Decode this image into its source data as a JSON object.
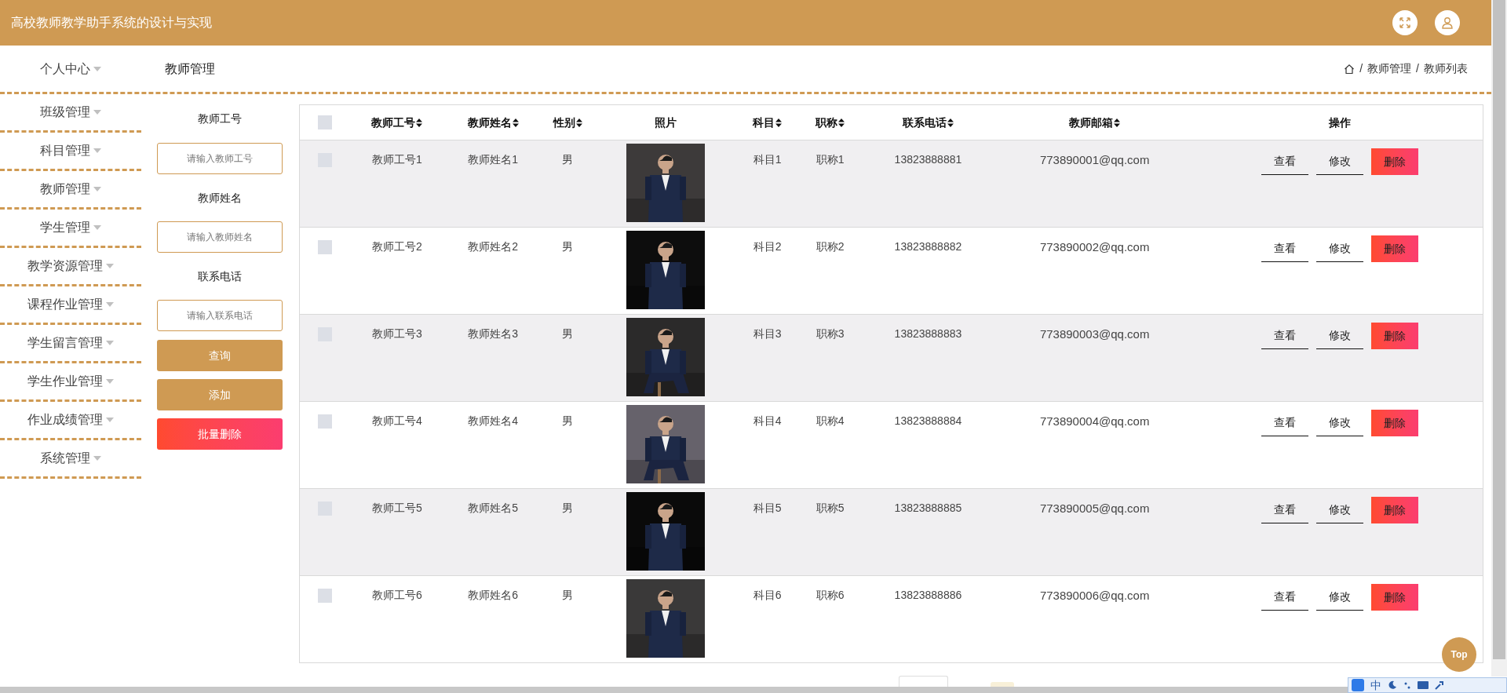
{
  "header": {
    "title": "高校教师教学助手系统的设计与实现"
  },
  "sidebar": {
    "items": [
      {
        "label": "个人中心"
      },
      {
        "label": "班级管理"
      },
      {
        "label": "科目管理"
      },
      {
        "label": "教师管理"
      },
      {
        "label": "学生管理"
      },
      {
        "label": "教学资源管理"
      },
      {
        "label": "课程作业管理"
      },
      {
        "label": "学生留言管理"
      },
      {
        "label": "学生作业管理"
      },
      {
        "label": "作业成绩管理"
      },
      {
        "label": "系统管理"
      }
    ]
  },
  "page_title": "教师管理",
  "breadcrumb": [
    {
      "separator": "/",
      "label": "教师管理"
    },
    {
      "separator": "/",
      "label": "教师列表"
    }
  ],
  "search": {
    "fields": [
      {
        "label": "教师工号",
        "placeholder": "请输入教师工号"
      },
      {
        "label": "教师姓名",
        "placeholder": "请输入教师姓名"
      },
      {
        "label": "联系电话",
        "placeholder": "请输入联系电话"
      }
    ],
    "buttons": [
      {
        "label": "查询",
        "kind": "primary"
      },
      {
        "label": "添加",
        "kind": "primary"
      },
      {
        "label": "批量删除",
        "kind": "danger"
      }
    ]
  },
  "table": {
    "select_all_checked": false,
    "columns": [
      {
        "label": "教师工号",
        "sortable": true
      },
      {
        "label": "教师姓名",
        "sortable": true
      },
      {
        "label": "性别",
        "sortable": true
      },
      {
        "label": "照片",
        "sortable": false
      },
      {
        "label": "科目",
        "sortable": true
      },
      {
        "label": "职称",
        "sortable": true
      },
      {
        "label": "联系电话",
        "sortable": true
      },
      {
        "label": "教师邮箱",
        "sortable": true
      },
      {
        "label": "操作",
        "sortable": false
      }
    ],
    "rows": [
      {
        "checked": false,
        "cells": [
          "教师工号1",
          "教师姓名1",
          "男",
          "",
          "科目1",
          "职称1",
          "13823888881",
          "773890001@qq.com"
        ],
        "actions": [
          {
            "label": "查看",
            "kind": "plain"
          },
          {
            "label": "修改",
            "kind": "plain"
          },
          {
            "label": "删除",
            "kind": "danger"
          }
        ]
      },
      {
        "checked": false,
        "cells": [
          "教师工号2",
          "教师姓名2",
          "男",
          "",
          "科目2",
          "职称2",
          "13823888882",
          "773890002@qq.com"
        ],
        "actions": [
          {
            "label": "查看",
            "kind": "plain"
          },
          {
            "label": "修改",
            "kind": "plain"
          },
          {
            "label": "删除",
            "kind": "danger"
          }
        ]
      },
      {
        "checked": false,
        "cells": [
          "教师工号3",
          "教师姓名3",
          "男",
          "",
          "科目3",
          "职称3",
          "13823888883",
          "773890003@qq.com"
        ],
        "actions": [
          {
            "label": "查看",
            "kind": "plain"
          },
          {
            "label": "修改",
            "kind": "plain"
          },
          {
            "label": "删除",
            "kind": "danger"
          }
        ]
      },
      {
        "checked": false,
        "cells": [
          "教师工号4",
          "教师姓名4",
          "男",
          "",
          "科目4",
          "职称4",
          "13823888884",
          "773890004@qq.com"
        ],
        "actions": [
          {
            "label": "查看",
            "kind": "plain"
          },
          {
            "label": "修改",
            "kind": "plain"
          },
          {
            "label": "删除",
            "kind": "danger"
          }
        ]
      },
      {
        "checked": false,
        "cells": [
          "教师工号5",
          "教师姓名5",
          "男",
          "",
          "科目5",
          "职称5",
          "13823888885",
          "773890005@qq.com"
        ],
        "actions": [
          {
            "label": "查看",
            "kind": "plain"
          },
          {
            "label": "修改",
            "kind": "plain"
          },
          {
            "label": "删除",
            "kind": "danger"
          }
        ]
      },
      {
        "checked": false,
        "cells": [
          "教师工号6",
          "教师姓名6",
          "男",
          "",
          "科目6",
          "职称6",
          "13823888886",
          "773890006@qq.com"
        ],
        "actions": [
          {
            "label": "查看",
            "kind": "plain"
          },
          {
            "label": "修改",
            "kind": "plain"
          },
          {
            "label": "删除",
            "kind": "danger"
          }
        ]
      }
    ]
  },
  "back_to_top": {
    "label": "Top"
  },
  "ime_bar": {
    "mode": "中"
  }
}
